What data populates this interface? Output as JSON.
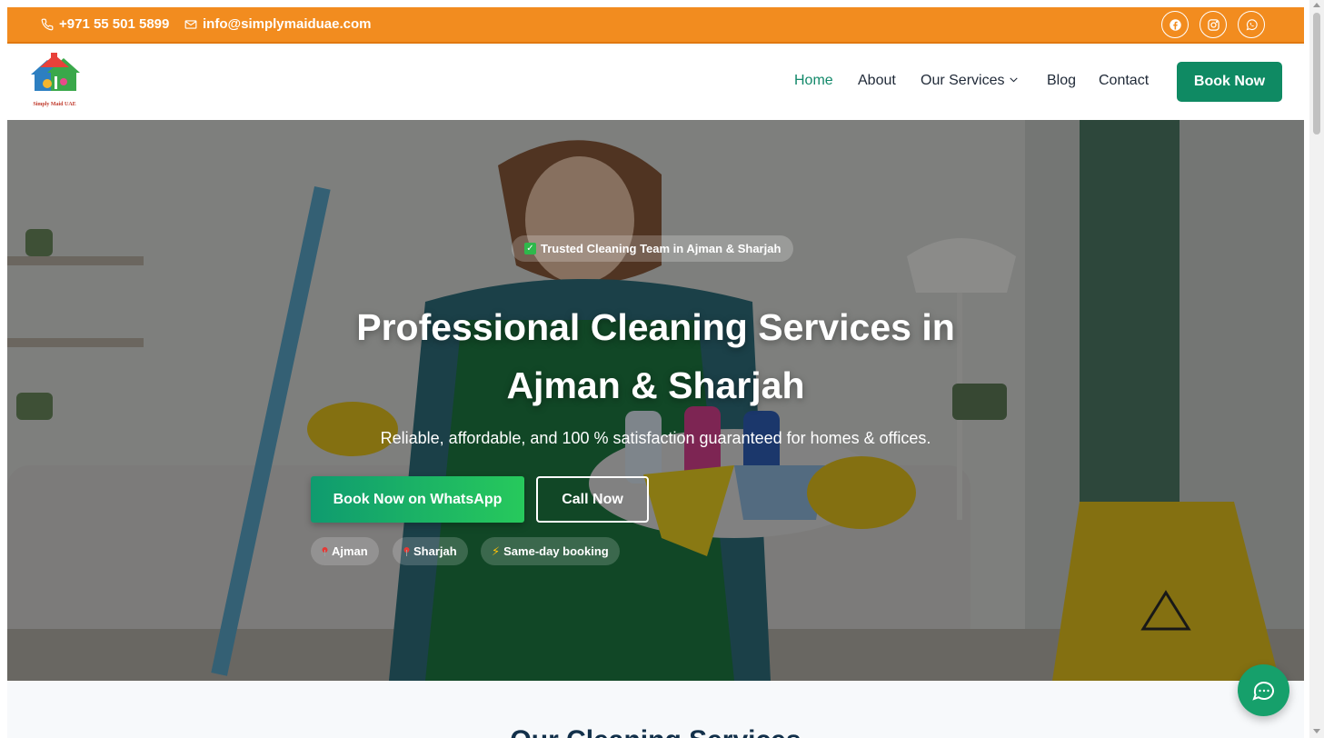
{
  "topbar": {
    "phone": "+971 55 501 5899",
    "email": "info@simplymaiduae.com",
    "socials": [
      "facebook-icon",
      "instagram-icon",
      "whatsapp-icon"
    ]
  },
  "navbar": {
    "logo_text": "Simply Maid UAE",
    "links": [
      {
        "label": "Home",
        "active": true
      },
      {
        "label": "About",
        "active": false
      },
      {
        "label": "Our Services",
        "active": false,
        "dropdown": true
      },
      {
        "label": "Blog",
        "active": false
      },
      {
        "label": "Contact",
        "active": false
      }
    ],
    "cta_label": "Book Now"
  },
  "hero": {
    "badge": "Trusted Cleaning Team in Ajman & Sharjah",
    "title_line1": "Professional Cleaning Services in",
    "title_line2": "Ajman & Sharjah",
    "subtitle": "Reliable, affordable, and 100 % satisfaction guaranteed for homes & offices.",
    "primary_cta": "Book Now on WhatsApp",
    "secondary_cta": "Call Now",
    "chips": [
      "Ajman",
      "Sharjah",
      "Same-day booking"
    ]
  },
  "next_section": {
    "heading": "Our Cleaning Services"
  },
  "colors": {
    "topbar": "#f28c1f",
    "brand_green": "#0f8a63",
    "active_link": "#13896a",
    "whatsapp_gradient_end": "#27c95c"
  }
}
